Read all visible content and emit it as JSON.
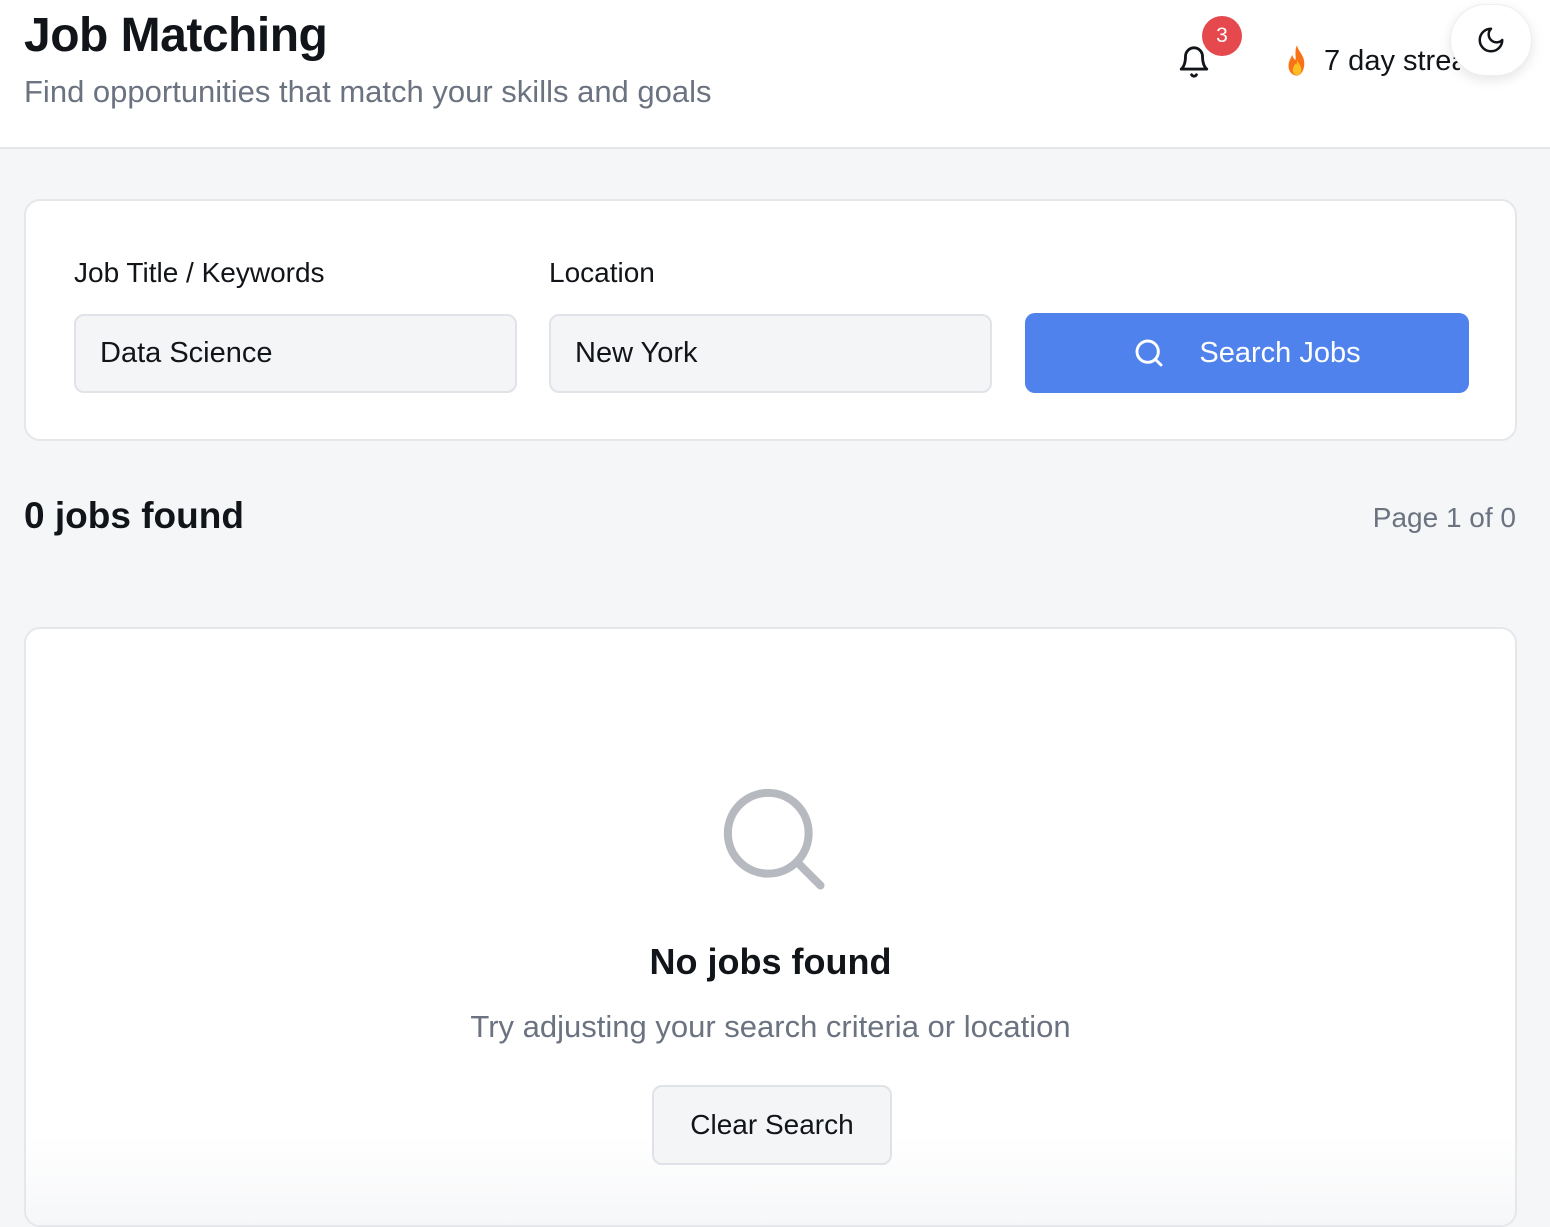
{
  "header": {
    "title": "Job Matching",
    "subtitle": "Find opportunities that match your skills and goals",
    "notifications": {
      "icon": "bell-icon",
      "count": "3"
    },
    "streak": {
      "icon": "flame-icon",
      "label": "7 day streak"
    },
    "theme_toggle": {
      "icon": "moon-icon"
    }
  },
  "search": {
    "keywords_label": "Job Title / Keywords",
    "keywords_value": "Data Science",
    "location_label": "Location",
    "location_value": "New York",
    "button_label": "Search Jobs",
    "button_icon": "search-icon"
  },
  "results": {
    "count_label": "0 jobs found",
    "page_label": "Page 1 of 0"
  },
  "empty_state": {
    "icon": "search-icon",
    "title": "No jobs found",
    "message": "Try adjusting your search criteria or location",
    "clear_label": "Clear Search"
  },
  "colors": {
    "accent": "#4f82ec",
    "badge": "#e5484d",
    "muted_text": "#6b7280",
    "background": "#f5f6f8"
  }
}
